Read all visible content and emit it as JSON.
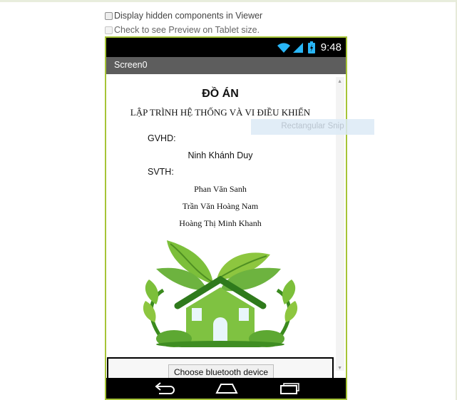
{
  "options": {
    "display_hidden": "Display hidden components in Viewer",
    "tablet_preview": "Check to see Preview on Tablet size."
  },
  "statusbar": {
    "time": "9:48"
  },
  "screen": {
    "title": "Screen0"
  },
  "content": {
    "title": "ĐỒ ÁN",
    "subtitle": "LẬP TRÌNH HỆ THỐNG VÀ VI ĐIỀU KHIỂN",
    "advisor_label": "GVHD:",
    "advisor_name": "Ninh Khánh Duy",
    "students_label": "SVTH:",
    "students": [
      "Phan Văn Sanh",
      "Trần Văn Hoàng Nam",
      "Hoàng Thị Minh Khanh"
    ]
  },
  "button": {
    "label": "Choose bluetooth device"
  },
  "overlay": {
    "label": "Rectangular Snip"
  },
  "colors": {
    "phone_border": "#a6c437",
    "titlebar": "#5d5d5d",
    "leaf_green": "#7cbf3a"
  }
}
